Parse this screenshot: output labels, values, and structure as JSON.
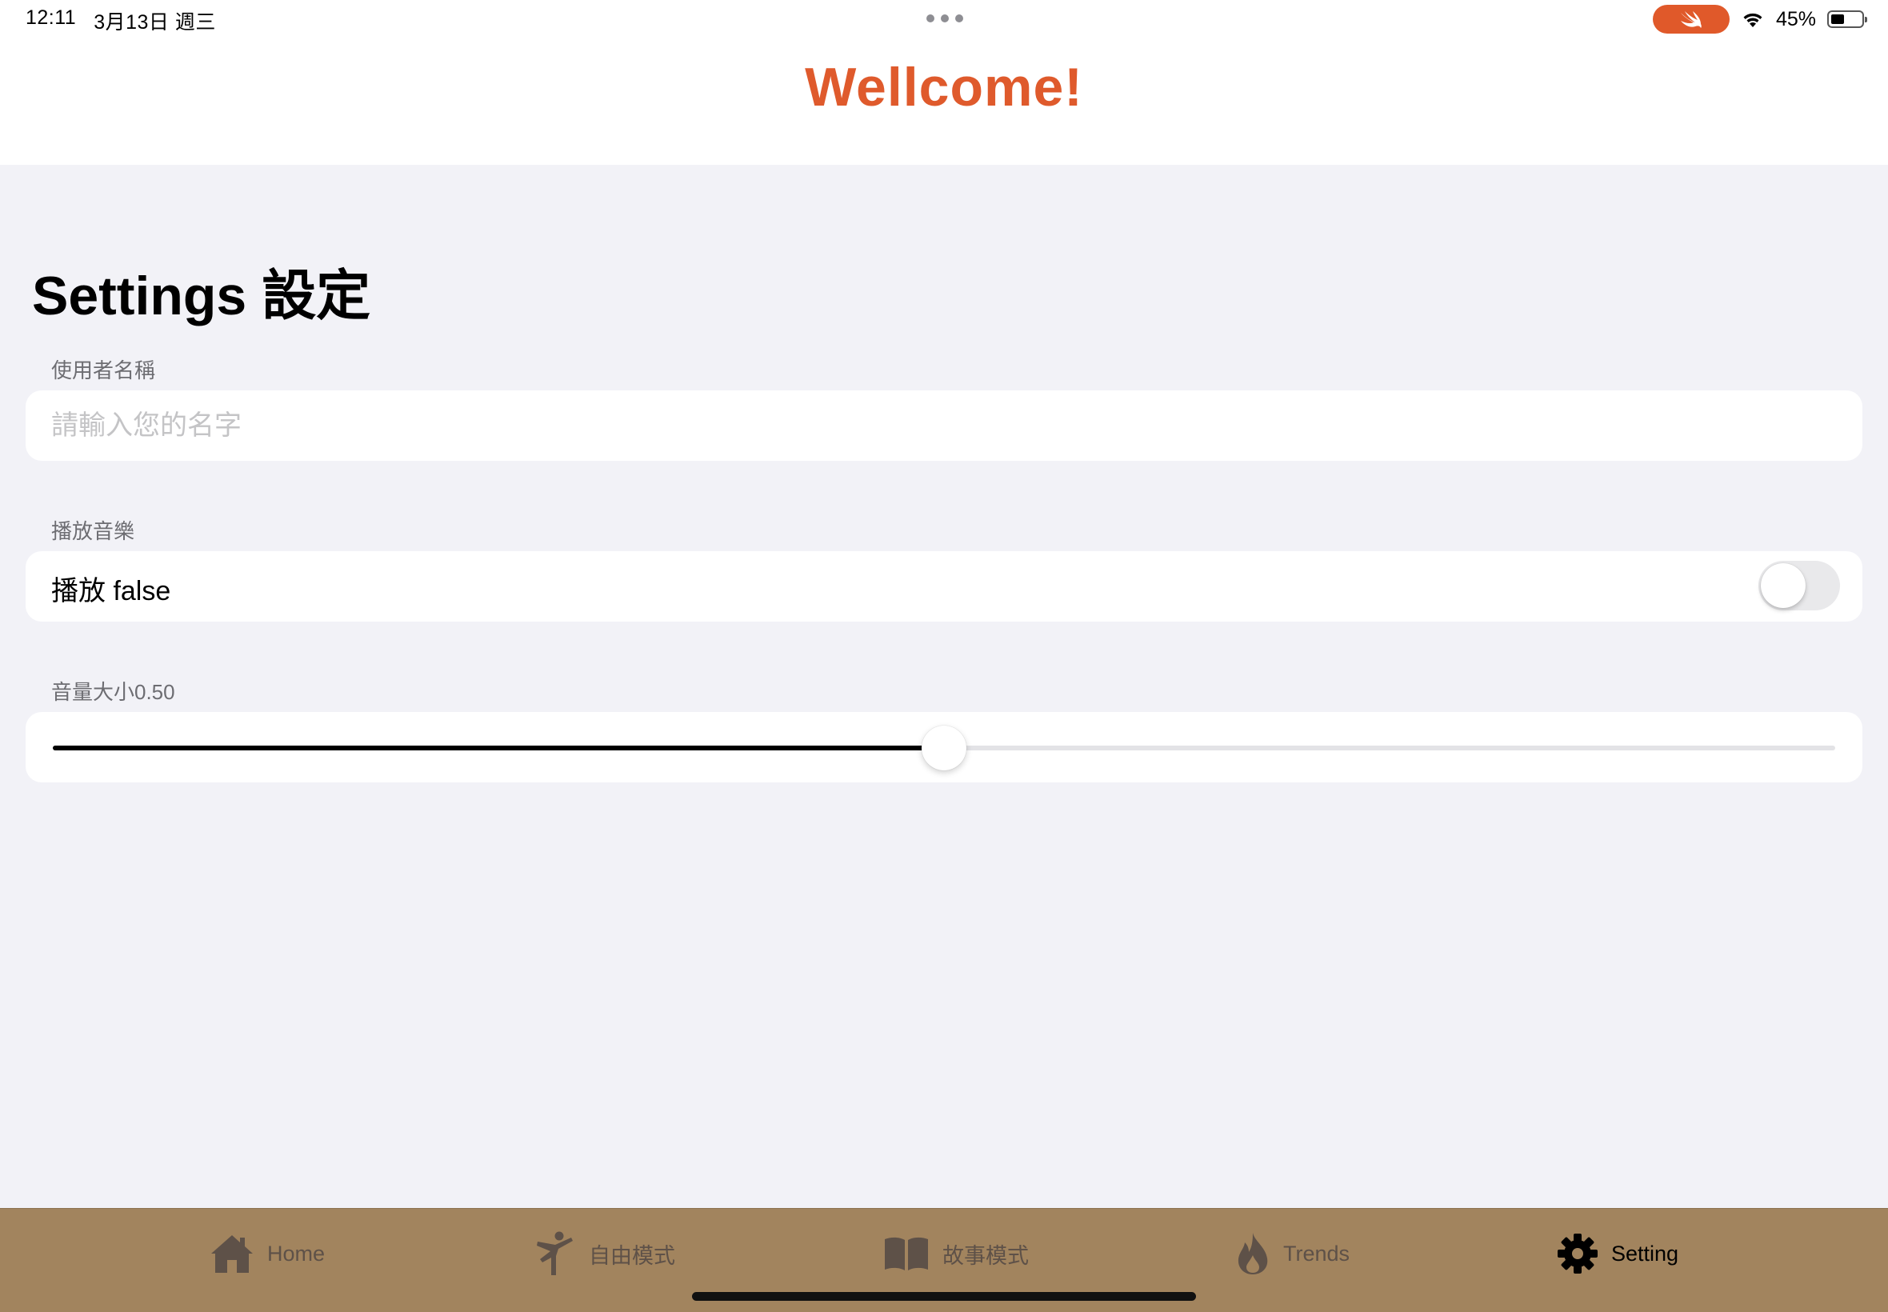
{
  "status_bar": {
    "time": "12:11",
    "date": "3月13日 週三",
    "battery": "45%",
    "accent_color": "#e0592a"
  },
  "header": {
    "title": "Wellcome!",
    "title_color": "#df5a2c"
  },
  "settings": {
    "title": "Settings 設定",
    "username": {
      "header": "使用者名稱",
      "value": "",
      "placeholder": "請輸入您的名字"
    },
    "music": {
      "header": "播放音樂",
      "label": "播放 false",
      "enabled": false
    },
    "volume": {
      "header": "音量大小0.50",
      "value": 0.5
    }
  },
  "tab_bar": {
    "background": "#a2845e",
    "active_tab": "Setting",
    "tabs": [
      {
        "label": "Home",
        "icon": "house-icon"
      },
      {
        "label": "自由模式",
        "icon": "figure-kick-icon"
      },
      {
        "label": "故事模式",
        "icon": "book-icon"
      },
      {
        "label": "Trends",
        "icon": "flame-icon"
      },
      {
        "label": "Setting",
        "icon": "gear-icon"
      }
    ]
  }
}
